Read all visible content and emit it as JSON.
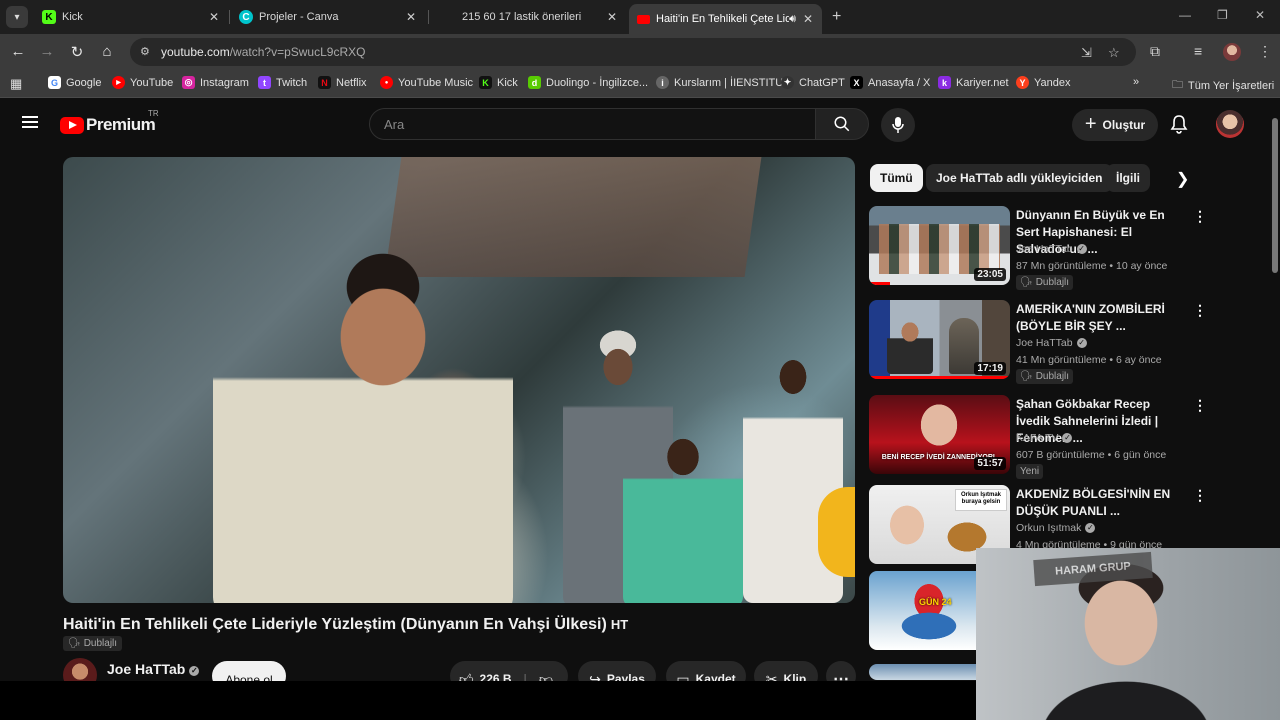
{
  "browser": {
    "tabs": [
      {
        "title": "Kick",
        "favicon_letter": "K",
        "favicon_color": "#53fc18"
      },
      {
        "title": "Projeler - Canva",
        "favicon_letter": "C",
        "favicon_color": "#00c4cc"
      },
      {
        "title": "215 60 17 lastik önerileri",
        "favicon_letter": "",
        "favicon_color": "#1f1f1f"
      },
      {
        "title": "Haiti'in En Tehlikeli Çete Lide",
        "favicon_letter": "",
        "favicon_color": "#ff0000",
        "active": true
      }
    ],
    "url_domain": "youtube.com",
    "url_path": "/watch?v=pSwucL9cRXQ",
    "bookmarks": [
      {
        "label": "Google",
        "icon_letter": "G",
        "color": "#4285f4"
      },
      {
        "label": "YouTube",
        "icon_letter": "▶",
        "color": "#ff0000"
      },
      {
        "label": "Instagram",
        "icon_letter": "◎",
        "color": "#d6249f"
      },
      {
        "label": "Twitch",
        "icon_letter": "t",
        "color": "#9146ff"
      },
      {
        "label": "Netflix",
        "icon_letter": "N",
        "color": "#e50914"
      },
      {
        "label": "YouTube Music",
        "icon_letter": "●",
        "color": "#ff0000"
      },
      {
        "label": "Kick",
        "icon_letter": "K",
        "color": "#53fc18"
      },
      {
        "label": "Duolingo - İngilizce...",
        "icon_letter": "d",
        "color": "#58cc02"
      },
      {
        "label": "Kurslarım | İIENSTITU",
        "icon_letter": "i",
        "color": "#888888"
      },
      {
        "label": "ChatGPT",
        "icon_letter": "✦",
        "color": "#333333"
      },
      {
        "label": "Anasayfa / X",
        "icon_letter": "X",
        "color": "#000000"
      },
      {
        "label": "Kariyer.net",
        "icon_letter": "k",
        "color": "#8a2be2"
      },
      {
        "label": "Yandex",
        "icon_letter": "Y",
        "color": "#fc3f1d"
      }
    ],
    "all_bookmarks_label": "Tüm Yer İşaretleri"
  },
  "youtube": {
    "logo_text": "Premium",
    "country_code": "TR",
    "search_placeholder": "Ara",
    "create_label": "Oluştur",
    "video": {
      "title": "Haiti'in En Tehlikeli Çete Lideriyle Yüzleştim (Dünyanın En Vahşi Ülkesi)",
      "title_suffix": "HT",
      "dub_badge": "Dublajlı",
      "channel": "Joe HaTTab",
      "subscribe_label": "Abone ol",
      "like_count": "226 B",
      "share_label": "Paylaş",
      "save_label": "Kaydet",
      "clip_label": "Klip"
    },
    "chips": [
      "Tümü",
      "Joe HaTTab adlı yükleyiciden",
      "İlgili"
    ],
    "recommendations": [
      {
        "title": "Dünyanın En Büyük ve En Sert Hapishanesi: El Salvador'un ...",
        "channel": "Joe HaTTab",
        "verified": true,
        "views": "87 Mn görüntüleme",
        "age": "10 ay önce",
        "tag": "Dublajlı",
        "duration": "23:05",
        "watched": 0.15
      },
      {
        "title": "AMERİKA'NIN ZOMBİLERİ (BÖYLE BİR ŞEY ...",
        "channel": "Joe HaTTab",
        "verified": true,
        "views": "41 Mn görüntüleme",
        "age": "6 ay önce",
        "tag": "Dublajlı",
        "duration": "17:19",
        "watched": 1.0
      },
      {
        "title": "Şahan Gökbakar Recep İvedik Sahnelerini İzledi | Fenomen ...",
        "channel": "KAFA TV",
        "verified": true,
        "views": "607 B görüntüleme",
        "age": "6 gün önce",
        "tag": "Yeni",
        "duration": "51:57",
        "watched": 0,
        "thumb_text": "BENİ RECEP İVEDİ ZANNEDİYORL"
      },
      {
        "title": "AKDENİZ BÖLGESİ'NİN EN DÜŞÜK PUANLI ...",
        "channel": "Orkun Işıtmak",
        "verified": true,
        "views": "4 Mn görüntüleme",
        "age": "9 gün önce",
        "tag": "",
        "duration": "",
        "watched": 0,
        "thumb_text": "Orkun Işıtmak buraya gelsin"
      },
      {
        "title": "",
        "channel": "",
        "views": "",
        "age": "",
        "tag": "",
        "duration": "",
        "watched": 0,
        "thumb_text": "GÜN 24"
      }
    ]
  },
  "webcam": {
    "sign_text": "HARAM GRUP"
  },
  "colors": {
    "accent": "#ff0000",
    "bg": "#0f0f0f",
    "chip_bg": "#272727"
  }
}
